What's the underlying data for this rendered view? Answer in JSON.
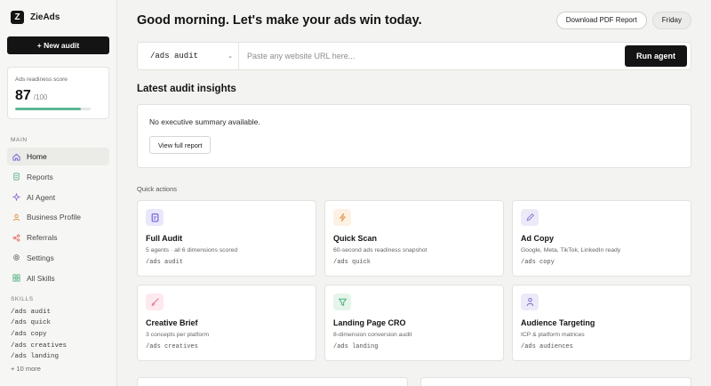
{
  "brand": {
    "logo_letter": "Z",
    "name": "ZieAds"
  },
  "sidebar": {
    "new_audit_label": "+ New audit",
    "score": {
      "label": "Ads readiness score",
      "value": "87",
      "max": "/100",
      "fraction": 0.87,
      "bar_color": "#5db896"
    },
    "main_label": "MAIN",
    "nav": [
      {
        "label": "Home",
        "icon": "home-icon",
        "color": "#6b5fd6"
      },
      {
        "label": "Reports",
        "icon": "document-icon",
        "color": "#4caf7a"
      },
      {
        "label": "AI Agent",
        "icon": "sparkle-icon",
        "color": "#8a63d2"
      },
      {
        "label": "Business Profile",
        "icon": "person-icon",
        "color": "#e08a3c"
      },
      {
        "label": "Referrals",
        "icon": "share-icon",
        "color": "#e0605a"
      },
      {
        "label": "Settings",
        "icon": "gear-icon",
        "color": "#777777"
      },
      {
        "label": "All Skills",
        "icon": "grid-icon",
        "color": "#4caf7a"
      }
    ],
    "skills_label": "SKILLS",
    "skills": [
      "/ads audit",
      "/ads quick",
      "/ads copy",
      "/ads creatives",
      "/ads landing"
    ],
    "more_label": "+ 10 more"
  },
  "header": {
    "greeting": "Good morning. Let's make your ads win today.",
    "download_label": "Download PDF Report",
    "day_label": "Friday"
  },
  "agent": {
    "selected_command": "/ads audit",
    "placeholder": "Paste any website URL here...",
    "run_label": "Run agent"
  },
  "insights": {
    "title": "Latest audit insights",
    "summary": "No executive summary available.",
    "view_label": "View full report"
  },
  "quick_actions": {
    "label": "Quick actions",
    "cards": [
      {
        "title": "Full Audit",
        "desc": "5 agents · all 6 dimensions scored",
        "cmd": "/ads audit",
        "icon": "clipboard-icon",
        "bg": "#e9e7fb",
        "fg": "#6b5fd6"
      },
      {
        "title": "Quick Scan",
        "desc": "60-second ads readiness snapshot",
        "cmd": "/ads quick",
        "icon": "lightning-icon",
        "bg": "#fdf1e3",
        "fg": "#e0a05a"
      },
      {
        "title": "Ad Copy",
        "desc": "Google, Meta, TikTok, LinkedIn ready",
        "cmd": "/ads copy",
        "icon": "pen-icon",
        "bg": "#eceaf8",
        "fg": "#8a7fd6"
      },
      {
        "title": "Creative Brief",
        "desc": "3 concepts per platform",
        "cmd": "/ads creatives",
        "icon": "brush-icon",
        "bg": "#fde9ee",
        "fg": "#e0728a"
      },
      {
        "title": "Landing Page CRO",
        "desc": "8-dimension conversion audit",
        "cmd": "/ads landing",
        "icon": "funnel-icon",
        "bg": "#e5f5ec",
        "fg": "#4caf7a"
      },
      {
        "title": "Audience Targeting",
        "desc": "ICP & platform matrices",
        "cmd": "/ads audiences",
        "icon": "people-icon",
        "bg": "#ece9f8",
        "fg": "#7a6fc6"
      }
    ]
  }
}
